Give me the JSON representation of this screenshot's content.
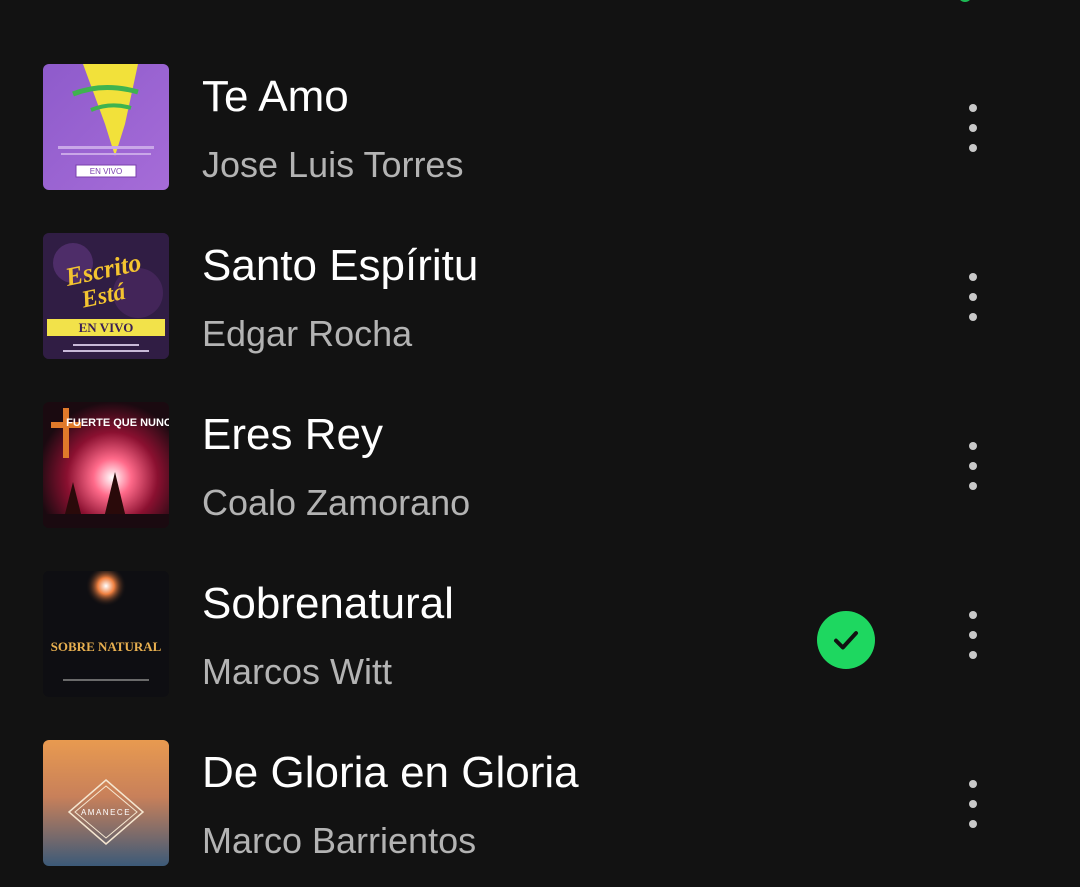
{
  "colors": {
    "background": "#121212",
    "title": "#FFFFFF",
    "subtitle": "#B3B3B3",
    "accent": "#1ED760"
  },
  "tracks": [
    {
      "title": "Te Amo",
      "artist": "Jose Luis Torres",
      "downloaded": false,
      "cover": {
        "icon": "album-cover-cantemos-a-jesus",
        "text": "EN VIVO"
      }
    },
    {
      "title": "Santo Espíritu",
      "artist": "Edgar Rocha",
      "downloaded": false,
      "cover": {
        "icon": "album-cover-escrito-esta",
        "text": "EN VIVO"
      }
    },
    {
      "title": "Eres Rey",
      "artist": "Coalo Zamorano",
      "downloaded": false,
      "cover": {
        "icon": "album-cover-mas-fuerte-que-nunca",
        "text": "FUERTE QUE NUNCA"
      }
    },
    {
      "title": "Sobrenatural",
      "artist": "Marcos Witt",
      "downloaded": true,
      "cover": {
        "icon": "album-cover-sobrenatural",
        "text": "SOBRE NATURAL"
      }
    },
    {
      "title": "De Gloria en Gloria",
      "artist": "Marco Barrientos",
      "downloaded": false,
      "cover": {
        "icon": "album-cover-amanece",
        "text": "AMANECE"
      }
    }
  ],
  "icons": {
    "downloaded": "check-circle-icon",
    "more": "more-vertical-icon"
  }
}
